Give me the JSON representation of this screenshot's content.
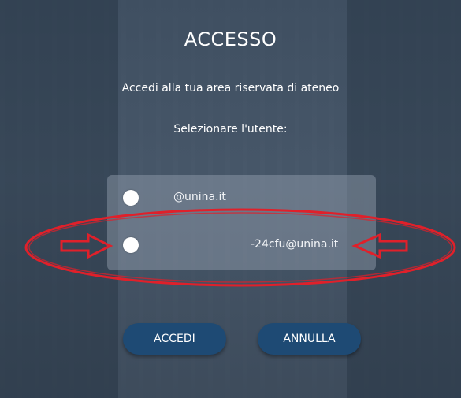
{
  "page": {
    "title": "ACCESSO",
    "subtitle": "Accedi alla tua area riservata di ateneo",
    "select_label": "Selezionare l'utente:"
  },
  "users": [
    {
      "label": "@unina.it",
      "selected": false
    },
    {
      "label": "-24cfu@unina.it",
      "selected": false
    }
  ],
  "buttons": {
    "accedi_label": "ACCEDI",
    "annulla_label": "ANNULLA"
  },
  "colors": {
    "button_bg": "#1e4a74",
    "annotation": "#e0202a",
    "background": "#4d5d70"
  }
}
